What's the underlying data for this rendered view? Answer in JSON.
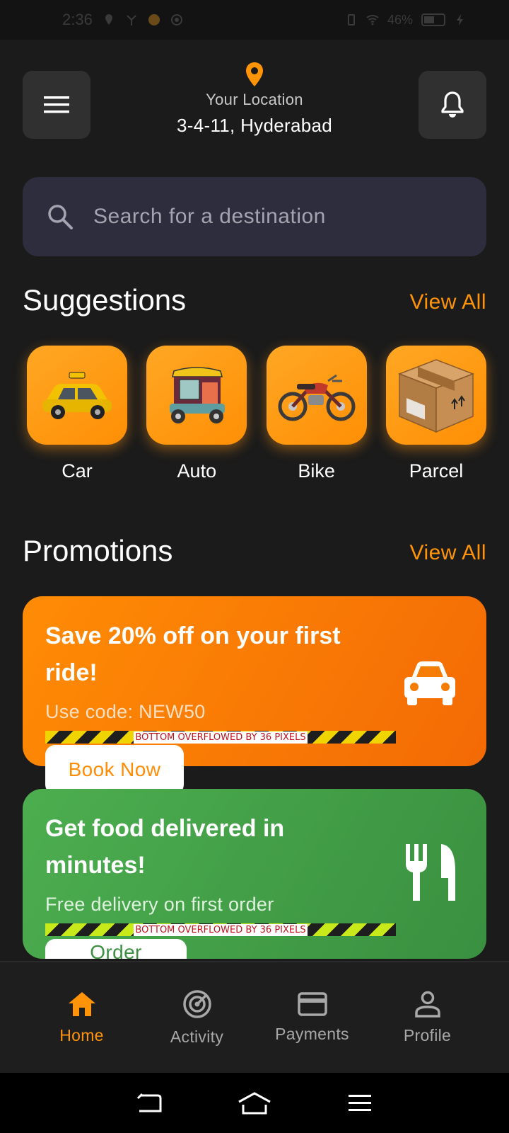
{
  "status_bar": {
    "time": "2:36",
    "battery": "46%"
  },
  "header": {
    "location_label": "Your Location",
    "location_value": "3-4-11, Hyderabad"
  },
  "search": {
    "placeholder": "Search for a destination"
  },
  "suggestions": {
    "title": "Suggestions",
    "view_all": "View All",
    "items": [
      {
        "label": "Car",
        "icon": "taxi-car-icon"
      },
      {
        "label": "Auto",
        "icon": "auto-rickshaw-icon"
      },
      {
        "label": "Bike",
        "icon": "motorbike-icon"
      },
      {
        "label": "Parcel",
        "icon": "parcel-box-icon"
      }
    ]
  },
  "promotions": {
    "title": "Promotions",
    "view_all": "View All",
    "cards": [
      {
        "title": "Save 20% off on your first ride!",
        "subtitle": "Use code: NEW50",
        "overflow_text": "BOTTOM OVERFLOWED BY 36 PIXELS",
        "button": "Book Now",
        "icon": "car-icon",
        "color": "#ff8c05"
      },
      {
        "title": "Get food delivered in minutes!",
        "subtitle": "Free delivery on first order",
        "overflow_text": "BOTTOM OVERFLOWED BY 36 PIXELS",
        "button": "Order Now",
        "icon": "restaurant-icon",
        "color": "#4cae4f"
      }
    ]
  },
  "bottom_nav": {
    "items": [
      {
        "label": "Home",
        "icon": "home-icon",
        "active": true
      },
      {
        "label": "Activity",
        "icon": "activity-icon",
        "active": false
      },
      {
        "label": "Payments",
        "icon": "credit-card-icon",
        "active": false
      },
      {
        "label": "Profile",
        "icon": "person-icon",
        "active": false
      }
    ]
  },
  "colors": {
    "accent": "#ff9408",
    "background": "#1b1b1b",
    "search_bg": "#2e2d3d"
  }
}
